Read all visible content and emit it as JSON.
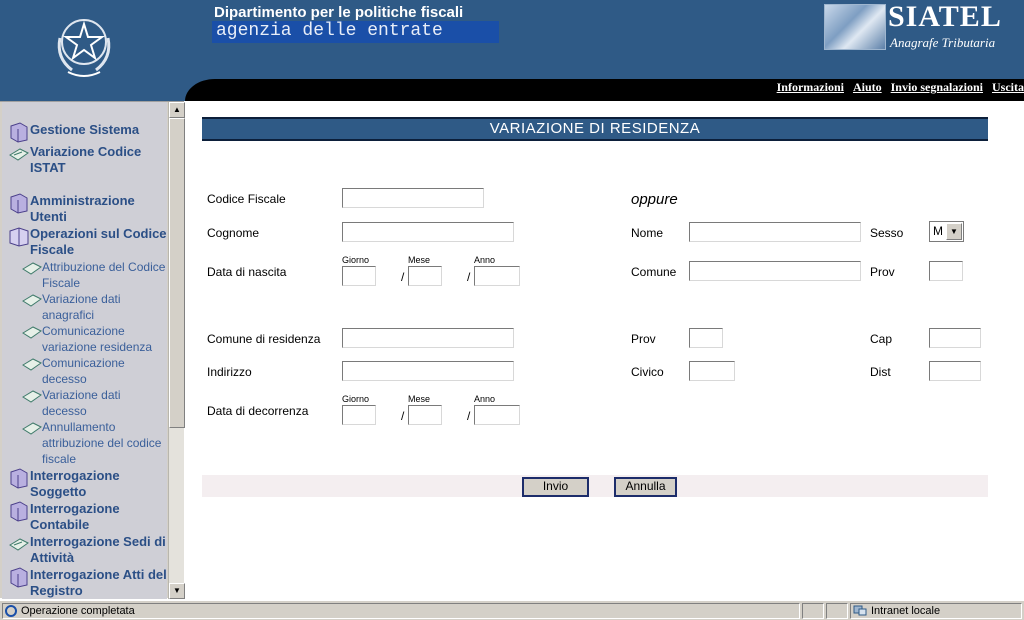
{
  "header": {
    "department": "Dipartimento per le politiche fiscali",
    "agency": "agenzia delle entrate",
    "brand": "SIATEL",
    "brand_sub": "Anagrafe Tributaria"
  },
  "topnav": [
    "Informazioni",
    "Aiuto",
    "Invio segnalazioni",
    "Uscita"
  ],
  "sidebar": {
    "items": [
      {
        "label": "Gestione Sistema",
        "icon": "book-icon"
      },
      {
        "label": "Variazione Codice ISTAT",
        "icon": "document-icon"
      },
      {
        "label": "Amministrazione Utenti",
        "icon": "book-icon"
      },
      {
        "label": "Operazioni sul Codice Fiscale",
        "icon": "open-book-icon"
      },
      {
        "label": "Interrogazione Soggetto",
        "icon": "book-icon"
      },
      {
        "label": "Interrogazione Contabile",
        "icon": "book-icon"
      },
      {
        "label": "Interrogazione Sedi di Attività",
        "icon": "document-icon"
      },
      {
        "label": "Interrogazione Atti del Registro",
        "icon": "book-icon"
      }
    ],
    "subitems": [
      "Attribuzione del Codice Fiscale",
      "Variazione dati anagrafici",
      "Comunicazione variazione residenza",
      "Comunicazione decesso",
      "Variazione dati decesso",
      "Annullamento attribuzione del codice fiscale"
    ]
  },
  "form": {
    "title": "VARIAZIONE DI RESIDENZA",
    "oppure": "oppure",
    "codice_fiscale": "Codice Fiscale",
    "cognome": "Cognome",
    "nome": "Nome",
    "sesso": "Sesso",
    "sesso_value": "M",
    "data_nascita": "Data di nascita",
    "giorno": "Giorno",
    "mese": "Mese",
    "anno": "Anno",
    "slash": "/",
    "comune": "Comune",
    "prov": "Prov",
    "comune_residenza": "Comune di residenza",
    "cap": "Cap",
    "indirizzo": "Indirizzo",
    "civico": "Civico",
    "dist": "Dist",
    "data_decorrenza": "Data di decorrenza",
    "invio": "Invio",
    "annulla": "Annulla"
  },
  "status": {
    "text": "Operazione completata",
    "zone": "Intranet locale"
  }
}
